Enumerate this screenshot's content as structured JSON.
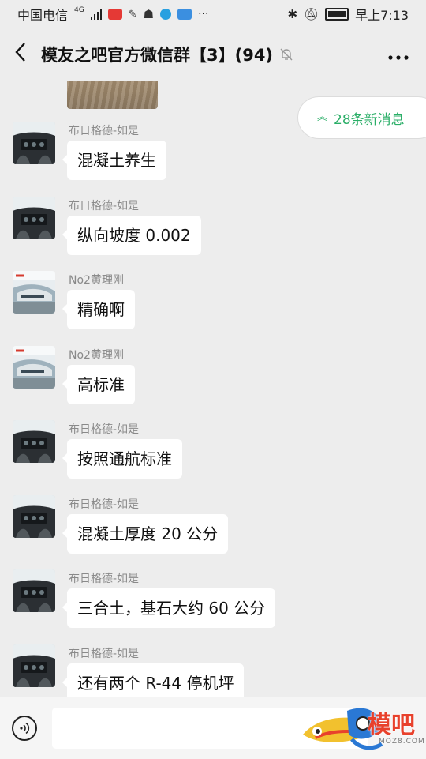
{
  "status_bar": {
    "carrier": "中国电信",
    "network": "4G",
    "time": "早上7:13",
    "icons": [
      "signal-icon",
      "news-app-icon",
      "weibo-icon",
      "qq-icon",
      "app-icon",
      "mail-app-icon",
      "more-dots-icon",
      "bluetooth-icon",
      "mute-icon",
      "battery-icon"
    ]
  },
  "nav": {
    "back_icon": "chevron-left-icon",
    "title": "模友之吧官方微信群【3】(94)",
    "mute_icon": "bell-off-icon",
    "more_icon": "more-dots-icon"
  },
  "new_messages": {
    "label": "28条新消息",
    "icon": "double-chevron-up-icon",
    "color": "#2aae67"
  },
  "messages": [
    {
      "sender": "布日格德-如是",
      "text": "混凝土养生",
      "avatar": "cockpit"
    },
    {
      "sender": "布日格德-如是",
      "text": "纵向坡度 0.002",
      "avatar": "cockpit"
    },
    {
      "sender": "No2黄理刚",
      "text": "精确啊",
      "avatar": "helicopter"
    },
    {
      "sender": "No2黄理刚",
      "text": "高标准",
      "avatar": "helicopter"
    },
    {
      "sender": "布日格德-如是",
      "text": "按照通航标准",
      "avatar": "cockpit"
    },
    {
      "sender": "布日格德-如是",
      "text": "混凝土厚度 20 公分",
      "avatar": "cockpit"
    },
    {
      "sender": "布日格德-如是",
      "text": "三合土，基石大约 60 公分",
      "avatar": "cockpit"
    },
    {
      "sender": "布日格德-如是",
      "text": "还有两个 R-44 停机坪",
      "avatar": "cockpit"
    }
  ],
  "input": {
    "voice_icon": "voice-icon",
    "placeholder": ""
  },
  "watermark": {
    "text": "模吧",
    "sub": "MOZ8.COM",
    "color": "#e8412c"
  }
}
